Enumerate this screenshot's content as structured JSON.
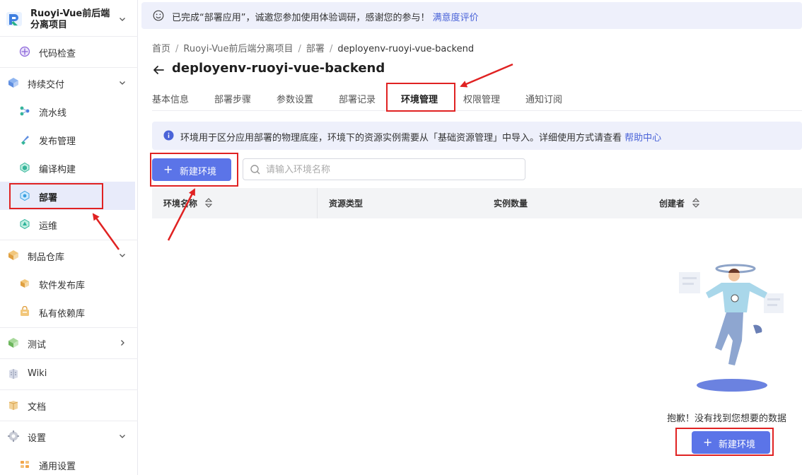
{
  "colors": {
    "accent": "#5b74e8",
    "link": "#4a63d8",
    "banner_bg": "#eef0fb",
    "active_bg": "#e8ebfa",
    "annotation_red": "#e02222"
  },
  "project": {
    "name": "Ruoyi-Vue前后端分离项目"
  },
  "sidebar": {
    "items": [
      {
        "label": "代码检查",
        "icon": "code-inspect-icon"
      },
      {
        "label": "持续交付",
        "icon": "delivery-icon"
      },
      {
        "label": "流水线",
        "icon": "pipeline-icon"
      },
      {
        "label": "发布管理",
        "icon": "release-icon"
      },
      {
        "label": "编译构建",
        "icon": "build-icon"
      },
      {
        "label": "部署",
        "icon": "deploy-icon"
      },
      {
        "label": "运维",
        "icon": "ops-icon"
      },
      {
        "label": "制品仓库",
        "icon": "artifact-icon"
      },
      {
        "label": "软件发布库",
        "icon": "software-repo-icon"
      },
      {
        "label": "私有依赖库",
        "icon": "private-dep-icon"
      },
      {
        "label": "测试",
        "icon": "test-icon"
      },
      {
        "label": "Wiki",
        "icon": "wiki-icon"
      },
      {
        "label": "文档",
        "icon": "docs-icon"
      },
      {
        "label": "设置",
        "icon": "settings-icon"
      },
      {
        "label": "通用设置",
        "icon": "general-settings-icon"
      }
    ]
  },
  "banner": {
    "text": "已完成“部署应用”，诚邀您参加使用体验调研，感谢您的参与！",
    "link": "满意度评价"
  },
  "breadcrumb": [
    "首页",
    "Ruoyi-Vue前后端分离项目",
    "部署",
    "deployenv-ruoyi-vue-backend"
  ],
  "page": {
    "title": "deployenv-ruoyi-vue-backend"
  },
  "tabs": [
    "基本信息",
    "部署步骤",
    "参数设置",
    "部署记录",
    "环境管理",
    "权限管理",
    "通知订阅"
  ],
  "active_tab": "环境管理",
  "info": {
    "text": "环境用于区分应用部署的物理底座，环境下的资源实例需要从「基础资源管理」中导入。详细使用方式请查看",
    "link": "帮助中心"
  },
  "toolbar": {
    "new_env_label": "新建环境",
    "search_placeholder": "请输入环境名称"
  },
  "table": {
    "columns": [
      "环境名称",
      "资源类型",
      "实例数量",
      "创建者"
    ]
  },
  "empty": {
    "text": "抱歉！没有找到您想要的数据",
    "button_label": "新建环境"
  }
}
